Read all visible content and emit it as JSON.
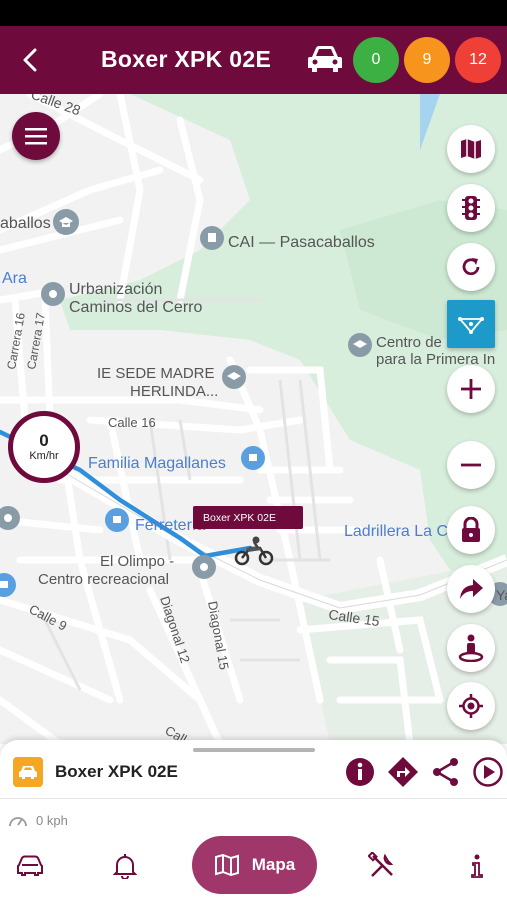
{
  "header": {
    "title": "Boxer XPK 02E",
    "counters": [
      {
        "value": "0",
        "color": "#3cb043"
      },
      {
        "value": "9",
        "color": "#f7941d"
      },
      {
        "value": "12",
        "color": "#ee4036"
      }
    ]
  },
  "map": {
    "labels": {
      "calle28": "Calle 28",
      "caballos": "aballos",
      "cai": "CAI — Pasacaballos",
      "ara": "Ara",
      "urbanizacion1": "Urbanización",
      "urbanizacion2": "Caminos del Cerro",
      "carrera16": "Carrera 16",
      "carrera17": "Carrera 17",
      "ie1": "IE SEDE MADRE",
      "ie2": "HERLINDA...",
      "centro1": "Centro de",
      "centro2": "para la Primera In",
      "calle16": "Calle 16",
      "familia": "Familia Magallanes",
      "ferreteria": "Ferretería",
      "ladrillera": "Ladrillera La C",
      "olimpo1": "El Olimpo -",
      "olimpo2": "Centro recreacional",
      "calle9": "Calle 9",
      "diagonal12": "Diagonal 12",
      "diagonal15": "Diagonal 15",
      "calle15": "Calle 15",
      "ya": "Ya",
      "calle": "Call"
    },
    "speed": {
      "value": "0",
      "unit": "Km/hr"
    },
    "vehicle_label": "Boxer XPK 02E",
    "controls": [
      "map-layers",
      "traffic-light",
      "refresh",
      "geofence",
      "zoom-in",
      "zoom-out",
      "lock",
      "share-route",
      "street-view",
      "my-location"
    ]
  },
  "sheet": {
    "vehicle_name": "Boxer XPK 02E",
    "speed_text": "0 kph",
    "actions": [
      "info",
      "directions",
      "share",
      "play"
    ]
  },
  "bottom_nav": {
    "active_label": "Mapa",
    "items": [
      "car",
      "notifications",
      "map",
      "tools",
      "info"
    ]
  },
  "colors": {
    "brand": "#6e0a3c",
    "brand_light": "#a0376b",
    "route": "#2f8fdb",
    "vehicle_icon_bg": "#f5a623"
  }
}
